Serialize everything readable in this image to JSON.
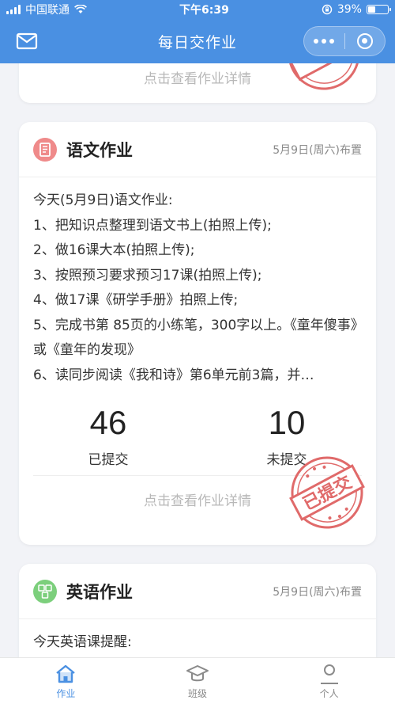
{
  "status_bar": {
    "carrier": "中国联通",
    "time": "下午6:39",
    "battery": "39%",
    "battery_level": 0.39
  },
  "nav": {
    "title": "每日交作业"
  },
  "colors": {
    "accent": "#4a90e2",
    "stamp": "#e06a6a",
    "chinese_icon": "#ef8a8a",
    "english_icon": "#7ccf7c"
  },
  "prev_card": {
    "detail_link": "点击查看作业详情"
  },
  "chinese_card": {
    "icon": "book-icon",
    "title": "语文作业",
    "date": "5月9日(周六)布置",
    "lines": [
      "今天(5月9日)语文作业:",
      "1、把知识点整理到语文书上(拍照上传);",
      "2、做16课大本(拍照上传);",
      "3、按照预习要求预习17课(拍照上传);",
      "4、做17课《研学手册》拍照上传;",
      "5、完成书第 85页的小练笔，300字以上。《童年傻事》或《童年的发现》",
      "6、读同步阅读《我和诗》第6单元前3篇，并…"
    ],
    "submitted_count": "46",
    "submitted_label": "已提交",
    "unsubmitted_count": "10",
    "unsubmitted_label": "未提交",
    "stamp_text": "已提交",
    "detail_link": "点击查看作业详情"
  },
  "english_card": {
    "icon": "abc-icon",
    "title": "英语作业",
    "date": "5月9日(周六)布置",
    "lines": [
      "今天英语课提醒:"
    ]
  },
  "tabbar": {
    "items": [
      {
        "label": "作业",
        "icon": "home-icon",
        "active": true
      },
      {
        "label": "班级",
        "icon": "graduation-cap-icon",
        "active": false
      },
      {
        "label": "个人",
        "icon": "person-icon",
        "active": false
      }
    ]
  }
}
